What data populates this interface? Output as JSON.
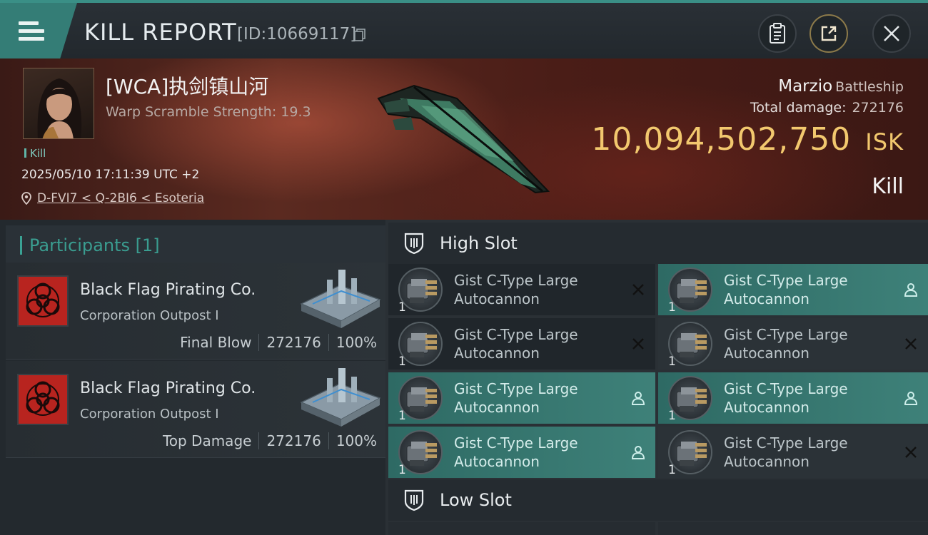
{
  "header": {
    "title": "KILL REPORT",
    "report_id": "[ID:10669117]"
  },
  "victim": {
    "pilot_name": "[WCA]执剑镇山河",
    "warp_scramble": "Warp Scramble Strength: 19.3",
    "kill_tag": "Kill",
    "timestamp": "2025/05/10 17:11:39 UTC +2",
    "location": "D-FVI7 < Q-2BI6 < Esoteria",
    "ship_name": "Marzio",
    "ship_class": "Battleship",
    "total_damage_label": "Total damage:",
    "total_damage": "272176",
    "isk_value": "10,094,502,750",
    "isk_unit": "ISK",
    "result": "Kill"
  },
  "participants": {
    "label": "Participants [1]",
    "items": [
      {
        "corp": "Black Flag Pirating Co.",
        "ship": "Corporation Outpost I",
        "role": "Final Blow",
        "damage": "272176",
        "percent": "100%"
      },
      {
        "corp": "Black Flag Pirating Co.",
        "ship": "Corporation Outpost I",
        "role": "Top Damage",
        "damage": "272176",
        "percent": "100%"
      }
    ]
  },
  "fitting": {
    "high_slot_label": "High Slot",
    "low_slot_label": "Low Slot",
    "high_slots": [
      {
        "name_line1": "Gist C-Type Large",
        "name_line2": "Autocannon",
        "qty": "1",
        "status": "destroyed"
      },
      {
        "name_line1": "Gist C-Type Large",
        "name_line2": "Autocannon",
        "qty": "1",
        "status": "dropped"
      },
      {
        "name_line1": "Gist C-Type Large",
        "name_line2": "Autocannon",
        "qty": "1",
        "status": "destroyed"
      },
      {
        "name_line1": "Gist C-Type Large",
        "name_line2": "Autocannon",
        "qty": "1",
        "status": "destroyed"
      },
      {
        "name_line1": "Gist C-Type Large",
        "name_line2": "Autocannon",
        "qty": "1",
        "status": "dropped"
      },
      {
        "name_line1": "Gist C-Type Large",
        "name_line2": "Autocannon",
        "qty": "1",
        "status": "dropped"
      },
      {
        "name_line1": "Gist C-Type Large",
        "name_line2": "Autocannon",
        "qty": "1",
        "status": "dropped"
      },
      {
        "name_line1": "Gist C-Type Large",
        "name_line2": "Autocannon",
        "qty": "1",
        "status": "destroyed"
      }
    ]
  },
  "icons": {
    "menu": "hamburger-menu-icon",
    "copy": "copy-icon",
    "clipboard": "clipboard-icon",
    "share": "share-icon",
    "close": "close-icon",
    "location": "location-pin-icon",
    "slot": "shield-slot-icon",
    "destroyed": "x-mark-icon",
    "dropped": "person-icon"
  },
  "colors": {
    "accent_teal": "#3a8f86",
    "isk_gold": "#f2c86e",
    "corp_red": "#b8241f"
  }
}
